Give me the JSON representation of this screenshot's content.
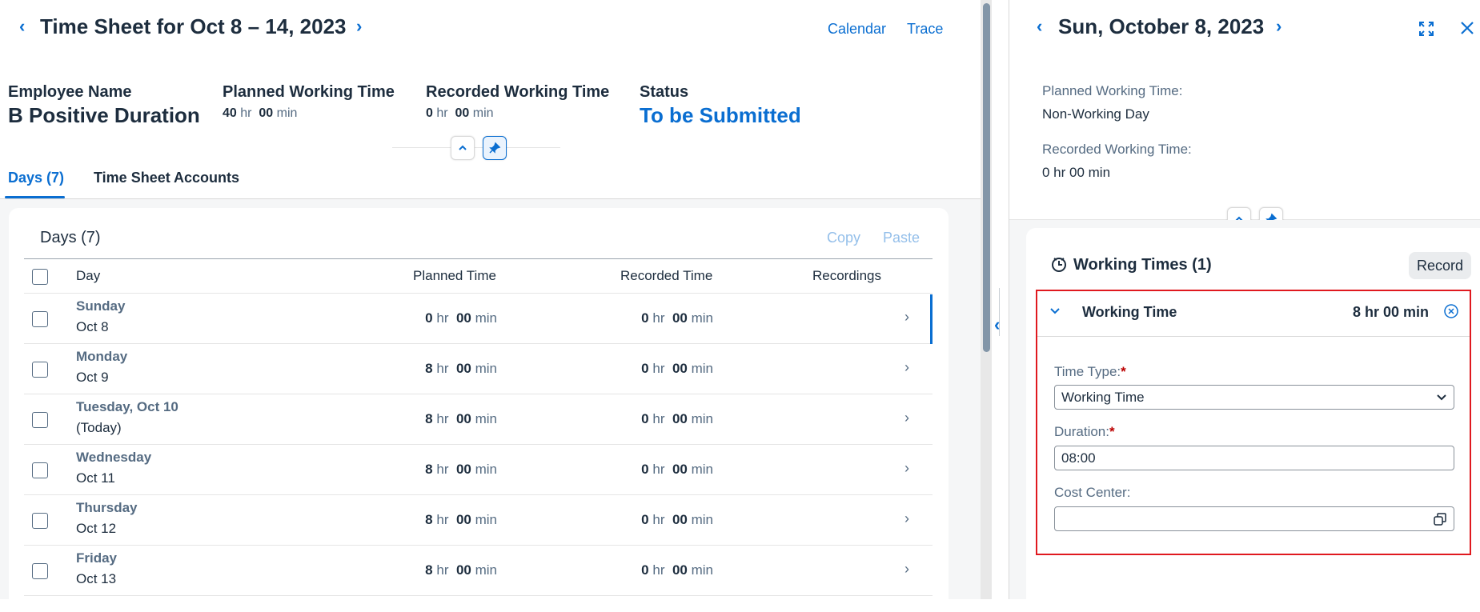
{
  "header": {
    "title": "Time Sheet for Oct 8 – 14, 2023",
    "calendar_link": "Calendar",
    "trace_link": "Trace"
  },
  "summary": {
    "employee_label": "Employee Name",
    "employee_value": "B Positive Duration",
    "planned_label": "Planned Working Time",
    "planned_hr": "40",
    "planned_min": "00",
    "recorded_label": "Recorded Working Time",
    "recorded_hr": "0",
    "recorded_min": "00",
    "status_label": "Status",
    "status_value": "To be Submitted",
    "hr_unit": "hr",
    "min_unit": "min"
  },
  "tabs": [
    {
      "label": "Days (7)",
      "selected": true
    },
    {
      "label": "Time Sheet Accounts",
      "selected": false
    }
  ],
  "days_table": {
    "title": "Days (7)",
    "copy_label": "Copy",
    "paste_label": "Paste",
    "columns": [
      "Day",
      "Planned Time",
      "Recorded Time",
      "Recordings"
    ],
    "rows": [
      {
        "name": "Sunday",
        "sub": "Oct 8",
        "planned_hr": "0",
        "planned_min": "00",
        "recorded_hr": "0",
        "recorded_min": "00"
      },
      {
        "name": "Monday",
        "sub": "Oct 9",
        "planned_hr": "8",
        "planned_min": "00",
        "recorded_hr": "0",
        "recorded_min": "00"
      },
      {
        "name": "Tuesday, Oct 10",
        "sub": "(Today)",
        "planned_hr": "8",
        "planned_min": "00",
        "recorded_hr": "0",
        "recorded_min": "00"
      },
      {
        "name": "Wednesday",
        "sub": "Oct 11",
        "planned_hr": "8",
        "planned_min": "00",
        "recorded_hr": "0",
        "recorded_min": "00"
      },
      {
        "name": "Thursday",
        "sub": "Oct 12",
        "planned_hr": "8",
        "planned_min": "00",
        "recorded_hr": "0",
        "recorded_min": "00"
      },
      {
        "name": "Friday",
        "sub": "Oct 13",
        "planned_hr": "8",
        "planned_min": "00",
        "recorded_hr": "0",
        "recorded_min": "00"
      }
    ]
  },
  "detail": {
    "title": "Sun, October 8, 2023",
    "planned_label": "Planned Working Time:",
    "planned_value": "Non-Working Day",
    "recorded_label": "Recorded Working Time:",
    "recorded_value": "0 hr 00 min",
    "working_times_title": "Working Times (1)",
    "record_button": "Record",
    "entry": {
      "title": "Working Time",
      "duration_text": "8 hr 00 min",
      "time_type_label": "Time Type:",
      "time_type_value": "Working Time",
      "duration_label": "Duration:",
      "duration_value": "08:00",
      "cost_center_label": "Cost Center:",
      "cost_center_value": ""
    }
  },
  "colors": {
    "accent": "#0a6ed1",
    "highlight_border": "#e0191f",
    "required": "#bb0000"
  }
}
